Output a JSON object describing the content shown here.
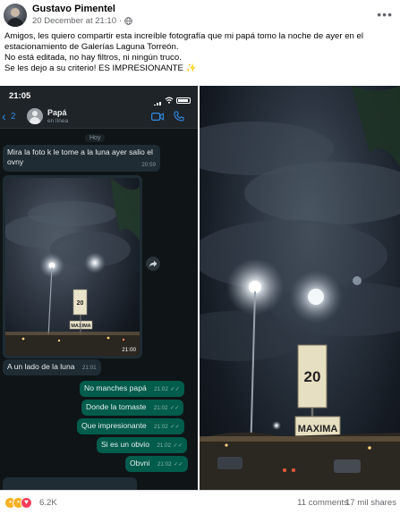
{
  "post": {
    "author": "Gustavo Pimentel",
    "timestamp": "20 December at 21:10",
    "separator": "·",
    "caption_lines": [
      "Amigos, les quiero compartir esta increíble fotografía que mi papá tomo la noche de ayer en el",
      "estacionamiento de Galerías Laguna Torreón.",
      "No está editada, no hay filtros, ni ningún truco.",
      "Se les dejo a su criterio! ES IMPRESIONANTE ✨"
    ],
    "more_icon": "more-horizontal-icon",
    "audience_icon": "globe-icon"
  },
  "chat": {
    "status_time": "21:05",
    "back_count": "2",
    "contact_name": "Papá",
    "contact_status": "en línea",
    "day_chip": "Hoy",
    "messages_in": [
      {
        "text": "Mira la foto k le tome a la luna ayer salio el ovny",
        "time": "20:59"
      },
      {
        "text": "A un lado de la luna",
        "time": "21:01"
      }
    ],
    "image_time": "21:00",
    "messages_out": [
      {
        "text": "No manches papá",
        "time": "21:02"
      },
      {
        "text": "Donde la tomaste",
        "time": "21:02"
      },
      {
        "text": "Que impresionante",
        "time": "21:02"
      },
      {
        "text": "Si es un obvio",
        "time": "21:02"
      },
      {
        "text": "Obvni",
        "time": "21:02"
      }
    ],
    "ticks": "✓✓"
  },
  "sign": {
    "number": "20",
    "brand": "MAXIMA"
  },
  "footer": {
    "reaction_count": "6.2K",
    "comments": "11 comments",
    "shares": "17 mil shares"
  },
  "colors": {
    "facebook_text": "#050505",
    "secondary_text": "#65676b",
    "whatsapp_out": "#005c4b",
    "whatsapp_in": "#1f2c33",
    "whatsapp_blue": "#2f8ce6"
  }
}
